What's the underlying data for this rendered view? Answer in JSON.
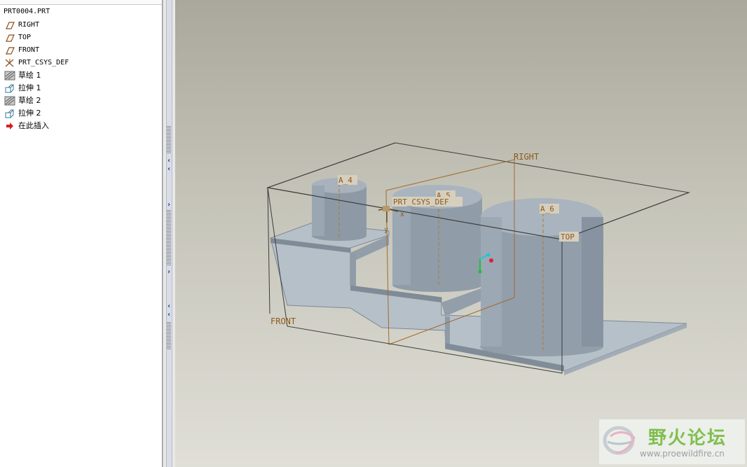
{
  "model_tree": {
    "root": "PRT0004.PRT",
    "items": [
      {
        "label": "RIGHT",
        "icon": "datum-plane-icon"
      },
      {
        "label": "TOP",
        "icon": "datum-plane-icon"
      },
      {
        "label": "FRONT",
        "icon": "datum-plane-icon"
      },
      {
        "label": "PRT_CSYS_DEF",
        "icon": "coordinate-system-icon"
      },
      {
        "label": "草绘 1",
        "icon": "sketch-icon"
      },
      {
        "label": "拉伸 1",
        "icon": "extrude-icon"
      },
      {
        "label": "草绘 2",
        "icon": "sketch-icon"
      },
      {
        "label": "拉伸 2",
        "icon": "extrude-icon"
      },
      {
        "label": "在此插入",
        "icon": "insert-here-arrow-icon"
      }
    ]
  },
  "viewport": {
    "datum_labels": {
      "right": "RIGHT",
      "top": "TOP",
      "front": "FRONT",
      "csys": "PRT_CSYS_DEF",
      "axis_4": "A_4",
      "axis_5": "A_5",
      "axis_6": "A_6",
      "csys_x": "x",
      "csys_y": "y"
    },
    "colors": {
      "datum": "#8a5a1c",
      "model_face": "#9aa7b3",
      "model_dark": "#7d8995"
    }
  },
  "watermark": {
    "title": "野火论坛",
    "url": "www.proewildfire.cn"
  }
}
